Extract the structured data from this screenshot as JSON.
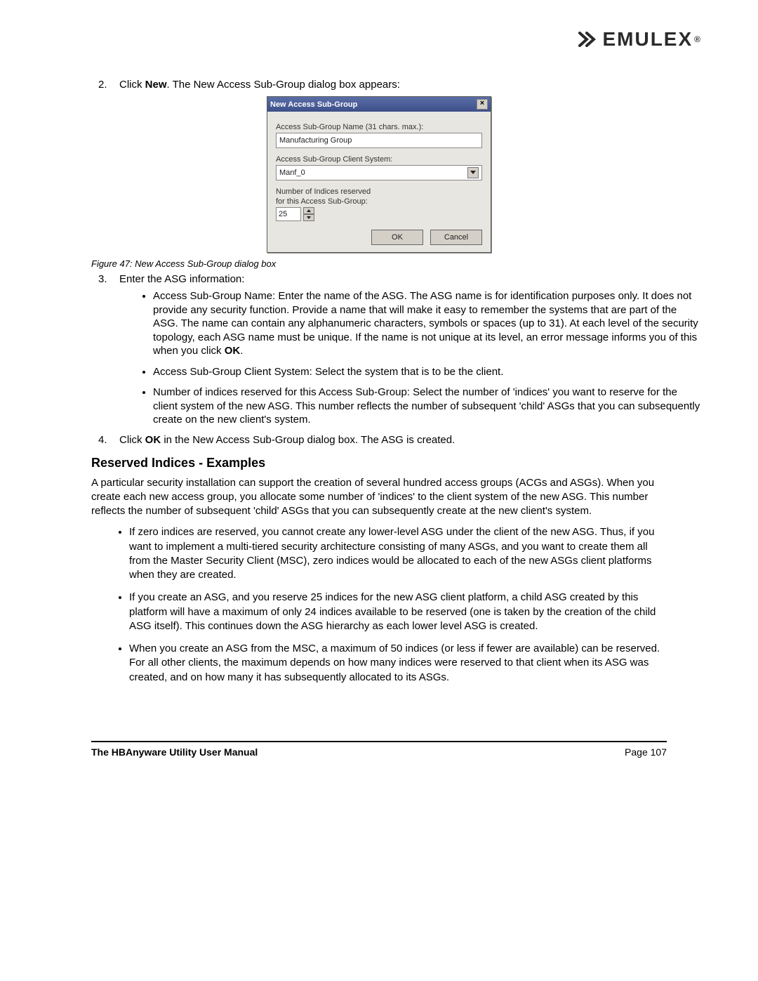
{
  "brand": {
    "name": "EMULEX"
  },
  "step2": {
    "num": "2.",
    "pre": "Click ",
    "bold": "New",
    "post": ". The New Access Sub-Group dialog box appears:"
  },
  "dialog": {
    "title": "New Access Sub-Group",
    "name_label": "Access Sub-Group Name (31 chars. max.):",
    "name_value": "Manufacturing Group",
    "client_label": "Access Sub-Group Client System:",
    "client_value": "Manf_0",
    "indices_label1": "Number of Indices reserved",
    "indices_label2": "for this Access Sub-Group:",
    "indices_value": "25",
    "ok": "OK",
    "cancel": "Cancel"
  },
  "figure_caption": "Figure 47: New Access Sub-Group dialog box",
  "step3": {
    "num": "3.",
    "text": "Enter the ASG information:"
  },
  "step3_bullets": [
    {
      "pre": "Access Sub-Group Name: Enter the name of the ASG. The ASG name is for identification purposes only. It does not provide any security function. Provide a name that will make it easy to remember the systems that are part of the ASG. The name can contain any alphanumeric characters, symbols or spaces (up to 31). At each level of the security topology, each ASG name must be unique. If the name is not unique at its level, an error message informs you of this when you click ",
      "bold": "OK",
      "post": "."
    },
    {
      "pre": "Access Sub-Group Client System: Select the system that is to be the client.",
      "bold": "",
      "post": ""
    },
    {
      "pre": "Number of indices reserved for this Access Sub-Group: Select the number of 'indices' you want to reserve for the client system of the new ASG. This number reflects the number of subsequent 'child' ASGs that you can subsequently create on the new client's system.",
      "bold": "",
      "post": ""
    }
  ],
  "step4": {
    "num": "4.",
    "pre": "Click ",
    "bold": "OK",
    "post": " in the New Access Sub-Group dialog box. The ASG is created."
  },
  "section_heading": "Reserved Indices - Examples",
  "section_para": "A particular security installation can support the creation of several hundred access groups (ACGs and ASGs). When you create each new access group, you allocate some number of 'indices' to the client system of the new ASG. This number reflects the number of subsequent 'child' ASGs that you can subsequently create at the new client's system.",
  "section_bullets": [
    "If zero indices are reserved, you cannot create any lower-level ASG under the client of the new ASG. Thus, if you want to implement a multi-tiered security architecture consisting of many ASGs, and you want to create them all from the Master Security Client (MSC), zero indices would be allocated to each of the new ASGs client platforms when they are created.",
    "If you create an ASG, and you reserve 25 indices for the new ASG client platform, a child ASG created by this platform will have a maximum of only 24 indices available to be reserved (one is taken by the creation of the child ASG itself). This continues down the ASG hierarchy as each lower level ASG is created.",
    "When you create an ASG from the MSC, a maximum of 50 indices (or less if fewer are available) can be reserved. For all other clients, the maximum depends on how many indices were reserved to that client when its ASG was created, and on how many it has subsequently allocated to its ASGs."
  ],
  "footer": {
    "left": "The HBAnyware Utility User Manual",
    "right": "Page 107"
  }
}
